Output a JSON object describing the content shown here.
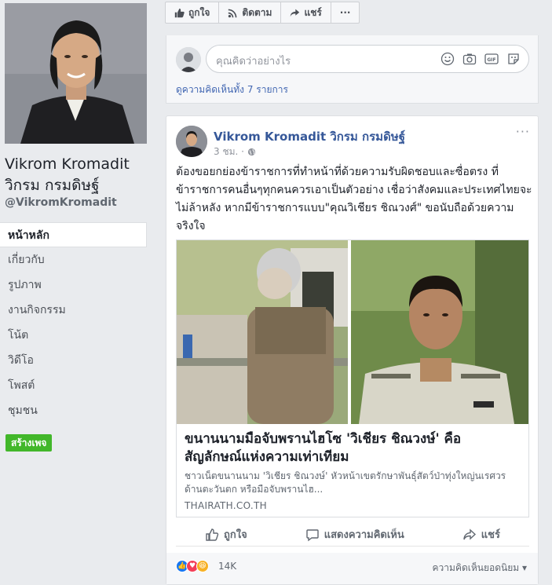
{
  "profile": {
    "name": "Vikrom Kromadit",
    "name_thai": "วิกรม กรมดิษฐ์",
    "handle": "@VikromKromadit"
  },
  "nav": {
    "items": [
      {
        "label": "หน้าหลัก"
      },
      {
        "label": "เกี่ยวกับ"
      },
      {
        "label": "รูปภาพ"
      },
      {
        "label": "งานกิจกรรม"
      },
      {
        "label": "โน้ต"
      },
      {
        "label": "วิดีโอ"
      },
      {
        "label": "โพสต์"
      },
      {
        "label": "ชุมชน"
      }
    ],
    "create_page": "สร้างเพจ"
  },
  "top_actions": {
    "like": "ถูกใจ",
    "follow": "ติดตาม",
    "share": "แชร์",
    "more": "···"
  },
  "comment_box": {
    "placeholder": "คุณคิดว่าอย่างไร",
    "view_all": "ดูความคิดเห็นทั้ง 7 รายการ"
  },
  "post": {
    "author": "Vikrom Kromadit วิกรม กรมดิษฐ์",
    "time": "3 ชม. ·",
    "menu": "···",
    "text": "ต้องขอยกย่องข้าราชการที่ทำหน้าที่ด้วยความรับผิดชอบและซื่อตรง ที่ข้าราชการคนอื่นๆทุกคนควรเอาเป็นตัวอย่าง เชื่อว่าสังคมและประเทศไทยจะไม่ล้าหลัง หากมีข้าราชการแบบ\"คุณวิเชียร ชิณวงศ์\" ขอนับถือด้วยความจริงใจ",
    "link": {
      "title": "ขนานนามมือจับพรานไฮโซ 'วิเชียร ชิณวงษ์' คือ สัญลักษณ์แห่งความเท่าเทียม",
      "description": "ชาวเน็ตขนานนาม 'วิเชียร ชิณวงษ์' หัวหน้าเขตรักษาพันธุ์สัตว์ป่าทุ่งใหญ่นเรศวรด้านตะวันตก หรือมือจับพรานไฮ...",
      "domain": "THAIRATH.CO.TH"
    },
    "actions": {
      "like": "ถูกใจ",
      "comment": "แสดงความคิดเห็น",
      "share": "แชร์"
    },
    "reaction_count": "14K",
    "top_comments": "ความคิดเห็นยอดนิยม ▾"
  },
  "colors": {
    "link_blue": "#365899",
    "create_green": "#42b72a",
    "like_blue": "#1877f2",
    "love_red": "#f33e58",
    "haha_yellow": "#f7b125"
  },
  "icons": [
    "thumbs-up-icon",
    "rss-icon",
    "share-arrow-icon",
    "smiley-icon",
    "camera-icon",
    "gif-icon",
    "sticker-icon",
    "globe-icon",
    "comment-icon"
  ]
}
